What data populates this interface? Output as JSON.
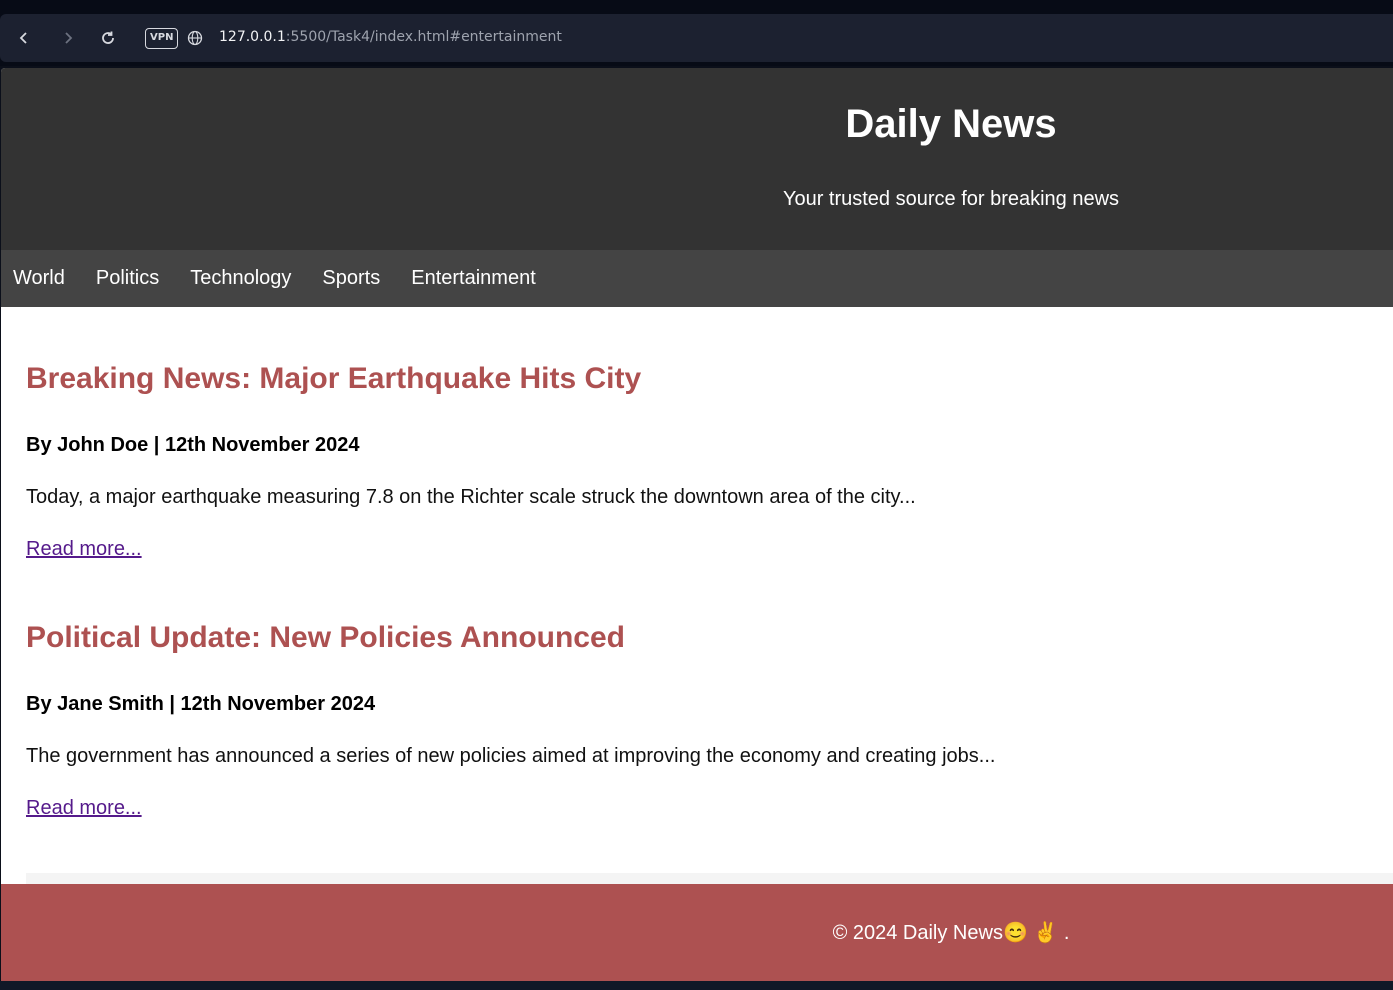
{
  "browser": {
    "back_icon": "chevron-left-icon",
    "forward_icon": "chevron-right-icon",
    "reload_icon": "reload-icon",
    "vpn_label": "VPN",
    "url_host": "127.0.0.1",
    "url_rest": ":5500/Task4/index.html#entertainment"
  },
  "header": {
    "title": "Daily News",
    "tagline": "Your trusted source for breaking news"
  },
  "nav": {
    "items": [
      "World",
      "Politics",
      "Technology",
      "Sports",
      "Entertainment"
    ]
  },
  "articles": [
    {
      "headline": "Breaking News: Major Earthquake Hits City",
      "byline": "By John Doe | 12th November 2024",
      "summary": "Today, a major earthquake measuring 7.8 on the Richter scale struck the downtown area of the city...",
      "link": "Read more..."
    },
    {
      "headline": "Political Update: New Policies Announced",
      "byline": "By Jane Smith | 12th November 2024",
      "summary": "The government has announced a series of new policies aimed at improving the economy and creating jobs...",
      "link": "Read more..."
    }
  ],
  "footer": {
    "text": "© 2024 Daily News😊 ✌️ ."
  },
  "colors": {
    "header_bg": "#333333",
    "nav_bg": "#444444",
    "accent": "#ad5151",
    "visited_link": "#551a8b"
  }
}
